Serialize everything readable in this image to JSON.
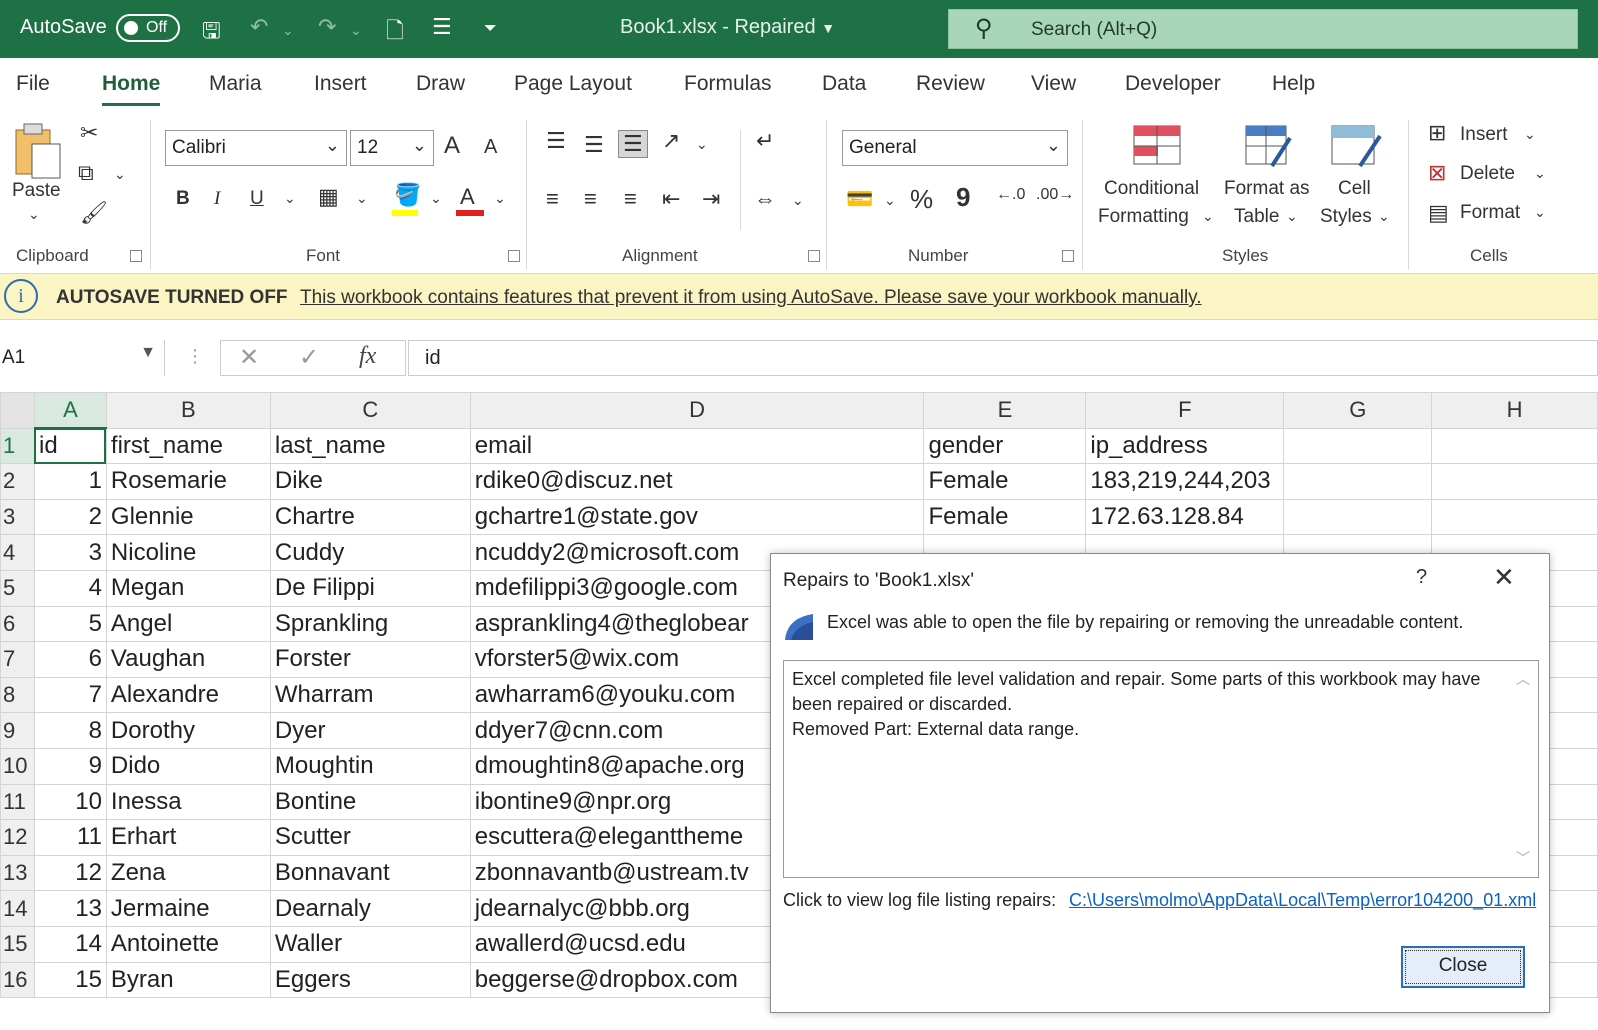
{
  "titlebar": {
    "autosave_label": "AutoSave",
    "autosave_state": "Off",
    "doc_title": "Book1.xlsx  -  Repaired",
    "search_placeholder": "Search (Alt+Q)",
    "background": "#1e7145"
  },
  "tabs": [
    "File",
    "Home",
    "Maria",
    "Insert",
    "Draw",
    "Page Layout",
    "Formulas",
    "Data",
    "Review",
    "View",
    "Developer",
    "Help"
  ],
  "active_tab": "Home",
  "ribbon": {
    "clipboard": {
      "paste": "Paste",
      "label": "Clipboard"
    },
    "font": {
      "name": "Calibri",
      "size": "12",
      "bold": "B",
      "italic": "I",
      "underline": "U",
      "grow": "A",
      "shrink": "A",
      "label": "Font",
      "highlight_color": "#ffff00",
      "font_color": "#e02020"
    },
    "alignment": {
      "label": "Alignment"
    },
    "number": {
      "format": "General",
      "percent": "%",
      "comma": "9",
      "label": "Number"
    },
    "styles": {
      "conditional_1": "Conditional",
      "conditional_2": "Formatting",
      "format_table_1": "Format as",
      "format_table_2": "Table",
      "cell_styles_1": "Cell",
      "cell_styles_2": "Styles",
      "label": "Styles"
    },
    "cells": {
      "insert": "Insert",
      "delete": "Delete",
      "format": "Format",
      "label": "Cells"
    }
  },
  "message_bar": {
    "title": "AUTOSAVE TURNED OFF",
    "text": "This workbook contains features that prevent it from using AutoSave. Please save your workbook manually."
  },
  "formula_bar": {
    "name_box": "A1",
    "fx": "fx",
    "value": "id"
  },
  "sheet": {
    "columns": [
      "A",
      "B",
      "C",
      "D",
      "E",
      "F",
      "G",
      "H"
    ],
    "rows": [
      {
        "n": "1",
        "id": "id",
        "first": "first_name",
        "last": "last_name",
        "email": "email",
        "gender": "gender",
        "ip": "ip_address"
      },
      {
        "n": "2",
        "id": "1",
        "first": "Rosemarie",
        "last": "Dike",
        "email": "rdike0@discuz.net",
        "gender": "Female",
        "ip": " 183,219,244,203"
      },
      {
        "n": "3",
        "id": "2",
        "first": "Glennie",
        "last": "Chartre",
        "email": "gchartre1@state.gov",
        "gender": "Female",
        "ip": "172.63.128.84"
      },
      {
        "n": "4",
        "id": "3",
        "first": "Nicoline",
        "last": "Cuddy",
        "email": "ncuddy2@microsoft.com",
        "gender": "",
        "ip": ""
      },
      {
        "n": "5",
        "id": "4",
        "first": "Megan",
        "last": "De Filippi",
        "email": "mdefilippi3@google.com",
        "gender": "",
        "ip": ""
      },
      {
        "n": "6",
        "id": "5",
        "first": "Angel",
        "last": "Sprankling",
        "email": "asprankling4@theglobear",
        "gender": "",
        "ip": ""
      },
      {
        "n": "7",
        "id": "6",
        "first": "Vaughan",
        "last": "Forster",
        "email": "vforster5@wix.com",
        "gender": "",
        "ip": ""
      },
      {
        "n": "8",
        "id": "7",
        "first": "Alexandre",
        "last": "Wharram",
        "email": "awharram6@youku.com",
        "gender": "",
        "ip": ""
      },
      {
        "n": "9",
        "id": "8",
        "first": "Dorothy",
        "last": "Dyer",
        "email": "ddyer7@cnn.com",
        "gender": "",
        "ip": ""
      },
      {
        "n": "10",
        "id": "9",
        "first": "Dido",
        "last": "Moughtin",
        "email": "dmoughtin8@apache.org",
        "gender": "",
        "ip": ""
      },
      {
        "n": "11",
        "id": "10",
        "first": "Inessa",
        "last": "Bontine",
        "email": "ibontine9@npr.org",
        "gender": "",
        "ip": ""
      },
      {
        "n": "12",
        "id": "11",
        "first": "Erhart",
        "last": "Scutter",
        "email": "escuttera@eleganttheme",
        "gender": "",
        "ip": ""
      },
      {
        "n": "13",
        "id": "12",
        "first": "Zena",
        "last": "Bonnavant",
        "email": "zbonnavantb@ustream.tv",
        "gender": "",
        "ip": ""
      },
      {
        "n": "14",
        "id": "13",
        "first": "Jermaine",
        "last": "Dearnaly",
        "email": "jdearnalyc@bbb.org",
        "gender": "",
        "ip": ""
      },
      {
        "n": "15",
        "id": "14",
        "first": "Antoinette",
        "last": "Waller",
        "email": "awallerd@ucsd.edu",
        "gender": "",
        "ip": ""
      },
      {
        "n": "16",
        "id": "15",
        "first": "Byran",
        "last": "Eggers",
        "email": "beggerse@dropbox.com",
        "gender": "",
        "ip": ""
      }
    ]
  },
  "dialog": {
    "title": "Repairs to 'Book1.xlsx'",
    "help": "?",
    "message": "Excel was able to open the file by repairing or removing the unreadable content.",
    "details_line1": "Excel completed file level validation and repair. Some parts of this workbook may have been repaired or discarded.",
    "details_line2": "Removed Part: External data range.",
    "log_label": "Click to view log file listing repairs:",
    "log_link": "C:\\Users\\molmo\\AppData\\Local\\Temp\\error104200_01.xml",
    "close_button": "Close"
  }
}
